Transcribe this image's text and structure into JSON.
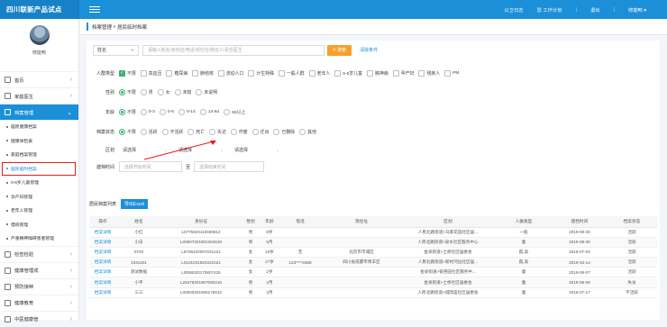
{
  "app": {
    "title": "四川联新产品试点"
  },
  "top_links": [
    "公卫日志",
    "工作计划",
    "退出",
    "修能鸭"
  ],
  "user": {
    "name": "修能鸭"
  },
  "sidebar": {
    "items": [
      {
        "label": "首页"
      },
      {
        "label": "家庭医生"
      },
      {
        "label": "档案管理",
        "active": true
      }
    ],
    "subitems": [
      "居民健康档案",
      "健康体检表",
      "家庭档案管理",
      "居民临时档案",
      "0-6岁儿童管理",
      "孕产妇管理",
      "老年人管理",
      "慢病管理",
      "严重精神障碍患者管理"
    ],
    "current_subitem": "居民临时档案",
    "bottom_items": [
      {
        "label": "检查检验"
      },
      {
        "label": "健康管理成"
      },
      {
        "label": "预防接种"
      },
      {
        "label": "健康教育"
      },
      {
        "label": "中医健康管"
      }
    ]
  },
  "breadcrumb": {
    "section": "档案管理",
    "page": "居民临时档案"
  },
  "search": {
    "field": "姓名",
    "placeholder": "请输入姓名/身份证/电话/现住址/随访人/责任医生",
    "button": "搜索",
    "clear": "清除条件"
  },
  "filters": {
    "crowd": {
      "label": "人群类型",
      "options": [
        "不限",
        "高血压",
        "糖尿病",
        "肺结核",
        "流动人口",
        "计生特殊",
        "一般人群",
        "老年人",
        "0-6岁儿童",
        "精神病",
        "孕产妇",
        "残疾人",
        "PM"
      ]
    },
    "gender": {
      "label": "性别",
      "options": [
        "不限",
        "男",
        "女",
        "未知",
        "未说明"
      ]
    },
    "age": {
      "label": "年龄",
      "options": [
        "不限",
        "0-3",
        "0-6",
        "0-14",
        "14-64",
        "65以上"
      ]
    },
    "status": {
      "label": "档案状态",
      "options": [
        "不限",
        "活跃",
        "不活跃",
        "死亡",
        "失访",
        "作废",
        "迁出",
        "已删除",
        "其他"
      ]
    },
    "region": {
      "label": "区划",
      "selects": [
        "请选择",
        "请选择",
        "请选择"
      ]
    },
    "date": {
      "label": "建档时间",
      "start": "选择开始时间",
      "to": "至",
      "end": "选择结束时间"
    }
  },
  "table": {
    "title": "居民档案列表",
    "export": "导出Excel",
    "headers": [
      "操作",
      "姓名",
      "身份证",
      "性别",
      "年龄",
      "电话",
      "现住址",
      "区划",
      "人群类型",
      "建档时间",
      "档案状态"
    ],
    "rows": [
      [
        "档案详情",
        "小红",
        "L0775620110830512",
        "男",
        "8岁",
        "",
        "",
        "人民北路街道>马家花园社区居...",
        "一般",
        "2019-08-30",
        "活跃"
      ],
      [
        "档案详情",
        "小白",
        "L0580720190130451​9",
        "男",
        "8月",
        "",
        "",
        "人民北路街道>泉水社区服务中心",
        "童",
        "2019-08-30",
        "活跃"
      ],
      [
        "档案详情",
        "0703",
        "L8765420007031221",
        "女",
        "19岁",
        "无",
        "北京市市城区",
        "金泉街道>土桥社区居委会",
        "孤,高",
        "2019-07-03",
        "活跃"
      ],
      [
        "档案详情",
        "1031401",
        "L0101031920321021",
        "女",
        "27岁",
        "123****3368",
        "四川省成都市青羊区",
        "人民北路街道>新村河边社区居...",
        "孤,高",
        "2019-03-14",
        "活跃"
      ],
      [
        "档案详情",
        "测试数据",
        "L0058020170807425",
        "女",
        "2岁",
        "",
        "",
        "金泉街道>银杏园社区服务中...",
        "童",
        "2019-08-07",
        "活跃"
      ],
      [
        "档案详情",
        "小平",
        "L2547820190708021​5",
        "男",
        "2月",
        "",
        "",
        "金泉街道>土桥社区居委会",
        "童",
        "2019-08-08",
        "失访"
      ],
      [
        "档案详情",
        "三三",
        "L0000020190617851​2",
        "男",
        "3月",
        "",
        "",
        "人民北路街道>城隍庙社区居委会",
        "童",
        "2019-07-17",
        "不活跃"
      ]
    ]
  }
}
